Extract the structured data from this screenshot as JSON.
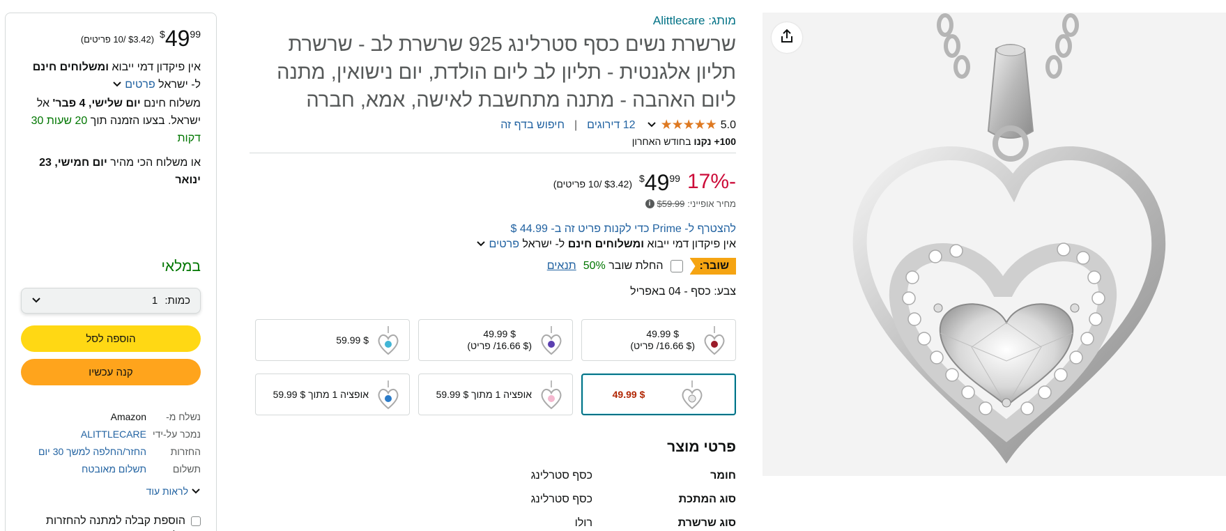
{
  "product": {
    "brand_prefix": "מותג:",
    "brand": "Alittlecare",
    "title": "שרשרת נשים כסף סטרלינג 925 שרשרת לב - שרשרת תליון אלגנטית - תליון לב ליום הולדת, יום נישואין, מתנה ליום האהבה - מתנה מתחשבת לאישה, אמא, חברה",
    "rating_value": "5.0",
    "stars": "★★★★★",
    "rating_count": "12 דירוגים",
    "search_page": "חיפוש בדף זה",
    "bought_bold": "100+ נקנו",
    "bought_rest": "בחודש האחרון"
  },
  "price": {
    "discount": "-17%",
    "symbol": "$",
    "whole": "49",
    "fraction": "99",
    "per_unit": "($3.42 /10 פריטים)",
    "list_label": "מחיר אופייני:",
    "list_value": "$59.99",
    "info_icon": "info-icon",
    "prime_line": "להצטרף ל- Prime כדי לקנות פריט זה ב- 44.99 $",
    "ship_prefix": "אין פיקדון דמי ייבוא",
    "ship_bold": "ומשלוחים חינם",
    "ship_to": "ל- ישראל",
    "details_link": "פרטים"
  },
  "coupon": {
    "badge": "שובר:",
    "apply": "החלת שובר",
    "pct": "50%",
    "terms": "תנאים"
  },
  "color_label": "צבע: כסף - 04 באפריל",
  "swatches": [
    {
      "l1": "$ 49.99",
      "l2": "($ 16.66/ פריט)",
      "gem": "#9b1c2a"
    },
    {
      "l1": "$ 49.99",
      "l2": "($ 16.66/ פריט)",
      "gem": "#5b3fb0"
    },
    {
      "l1": "$ 59.99",
      "l2": "",
      "gem": "#41b6d6"
    },
    {
      "l1": "$ 49.99",
      "l2": "",
      "gem": "#e8e8e8",
      "selected": true
    },
    {
      "l1": "אופציה 1 מתוך $ 59.99",
      "l2": "",
      "gem": "#f4b8cf"
    },
    {
      "l1": "אופציה 1 מתוך $ 59.99",
      "l2": "",
      "gem": "#2b7bc8"
    }
  ],
  "details": {
    "title": "פרטי מוצר",
    "rows": [
      {
        "k": "חומר",
        "v": "כסף סטרלינג"
      },
      {
        "k": "סוג המתכת",
        "v": "כסף סטרלינג"
      },
      {
        "k": "סוג שרשרת",
        "v": "רולו"
      }
    ]
  },
  "buybox": {
    "symbol": "$",
    "whole": "49",
    "fraction": "99",
    "per_unit": "($3.42 /10 פריטים)",
    "ship_prefix": "אין פיקדון דמי ייבוא",
    "ship_bold": "ומשלוחים חינם",
    "ship_to": "ל- ישראל",
    "details_link": "פרטים",
    "delivery_prefix": "משלוח חינם",
    "delivery_date": "יום שלישי, 4 פבר'",
    "delivery_to": "אל ישראל. בצעו הזמנה תוך",
    "countdown": "20 שעות 30 דקות",
    "fastest_prefix": "או משלוח הכי מהיר",
    "fastest_date": "יום חמישי, 23 ינואר",
    "stock": "במלאי",
    "qty_label": "כמות:",
    "qty_value": "1",
    "add_to_cart": "הוספה לסל",
    "buy_now": "קנה עכשיו",
    "info": [
      {
        "k": "נשלח מ-",
        "v": "Amazon",
        "link": false
      },
      {
        "k": "נמכר על-ידי",
        "v": "ALITTLECARE",
        "link": true
      },
      {
        "k": "החזרות",
        "v": "החזר/החלפה למשך 30 יום",
        "link": true
      },
      {
        "k": "תשלום",
        "v": "תשלום מאובטח",
        "link": true
      }
    ],
    "see_more": "לראות עוד",
    "gift": "הוספת קבלה למתנה להחזרות קלות"
  },
  "icons": {
    "share": "share-icon",
    "chevron": "chevron-down-icon"
  },
  "colors": {
    "accent_link": "#2162a1",
    "discount_red": "#cc0c39",
    "in_stock_green": "#007600",
    "cart_yellow": "#ffd814",
    "buy_orange": "#ffa41c"
  }
}
